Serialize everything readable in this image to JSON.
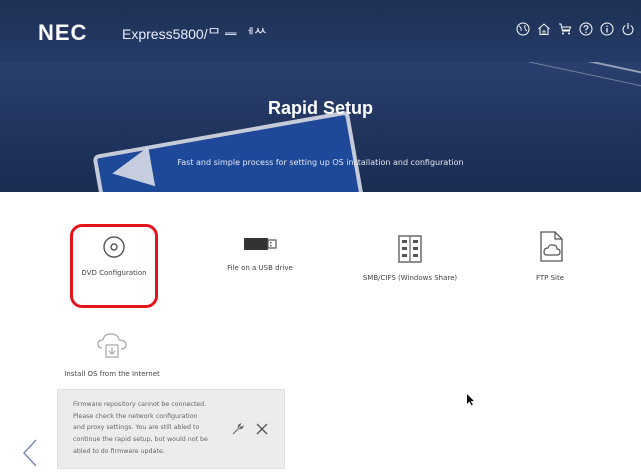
{
  "header": {
    "logo": "NEC",
    "product": "Express5800/ᄆ ᆖ ᅦᄊ",
    "icons": [
      "globe-icon",
      "home-icon",
      "cart-icon",
      "help-icon",
      "info-icon",
      "power-icon"
    ]
  },
  "hero": {
    "title": "Rapid Setup",
    "subtitle": "Fast and simple process for setting up OS installation and configuration"
  },
  "tiles": [
    {
      "label": "DVD Configuration",
      "icon": "disc-icon",
      "selected": true
    },
    {
      "label": "File on a USB drive",
      "icon": "usb-drive-icon"
    },
    {
      "label": "SMB/CIFS (Windows Share)",
      "icon": "network-share-icon"
    },
    {
      "label": "FTP Site",
      "icon": "cloud-file-icon"
    },
    {
      "label": "Install OS from the Internet",
      "icon": "cloud-install-icon"
    }
  ],
  "toast": {
    "lines": [
      "Firmware repository cannot be connected.",
      "Please check the network configuration",
      "and proxy settings. You are still abled to",
      "continue the rapid setup, but would not be",
      "abled to do firmware update."
    ]
  },
  "colors": {
    "header_bg": "#1f3054",
    "selection_border": "#e3141c",
    "icon_gray": "#555555"
  }
}
